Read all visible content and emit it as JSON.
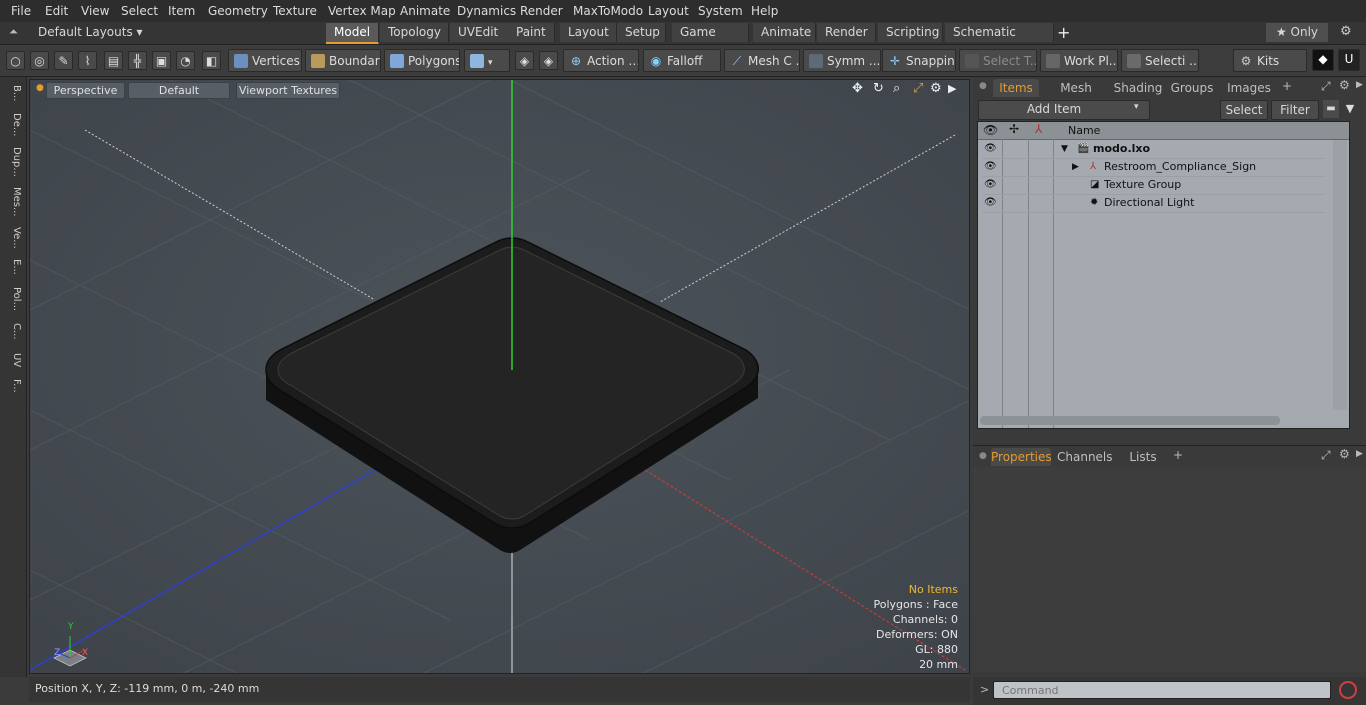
{
  "menu": [
    "File",
    "Edit",
    "View",
    "Select",
    "Item",
    "Geometry",
    "Texture",
    "Vertex Map",
    "Animate",
    "Dynamics",
    "Render",
    "MaxToModo",
    "Layout",
    "System",
    "Help"
  ],
  "layout_selector": "Default Layouts ▾",
  "layout_tabs": [
    "Model",
    "Topology",
    "UVEdit",
    "Paint",
    "Layout",
    "Setup",
    "Game Tools",
    "Animate",
    "Render",
    "Scripting",
    "Schematic Fusion"
  ],
  "layout_active": "Model",
  "only_label": "★ Only",
  "toolbar": {
    "vertices": "Vertices",
    "boundary": "Boundary",
    "polygons": "Polygons",
    "action": "Action",
    "falloff": "Falloff",
    "mesh": "Mesh C ...",
    "symm": "Symm ...",
    "snapping": "Snapping",
    "select_t": "Select T...",
    "work_pl": "Work Pl...",
    "selecti": "Selecti ...",
    "kits": "Kits"
  },
  "left_tabs": [
    "B...",
    "De...",
    "Dup...",
    "Mes...",
    "Ve...",
    "E...",
    "Pol...",
    "C...",
    "UV",
    "F..."
  ],
  "viewport": {
    "view": "Perspective",
    "shading": "Default",
    "textures": "Viewport Textures",
    "hud": {
      "no_items": "No Items",
      "polygons": "Polygons : Face",
      "channels": "Channels: 0",
      "deformers": "Deformers: ON",
      "gl": "GL: 880",
      "scale": "20 mm"
    },
    "axis_labels": {
      "y": "Y",
      "x": "X",
      "z": "Z"
    }
  },
  "items_panel": {
    "tabs": [
      "Items",
      "Mesh Ops",
      "Shading",
      "Groups",
      "Images"
    ],
    "active_tab": "Items",
    "add_item": "Add Item",
    "select": "Select",
    "filter": "Filter",
    "col_name": "Name",
    "rows": [
      {
        "name": "modo.lxo",
        "bold": true
      },
      {
        "name": "Restroom_Compliance_Sign",
        "bold": false
      },
      {
        "name": "Texture Group",
        "bold": false
      },
      {
        "name": "Directional Light",
        "bold": false
      }
    ]
  },
  "props_panel": {
    "tabs": [
      "Properties",
      "Channels",
      "Lists"
    ],
    "active_tab": "Properties"
  },
  "status": "Position X, Y, Z:   -119 mm, 0 m, -240 mm",
  "command_placeholder": "Command",
  "colors": {
    "accent": "#e49b2f",
    "y_axis": "#2fd02f",
    "x_axis": "#c83a3a",
    "z_axis": "#2f3fd0"
  }
}
